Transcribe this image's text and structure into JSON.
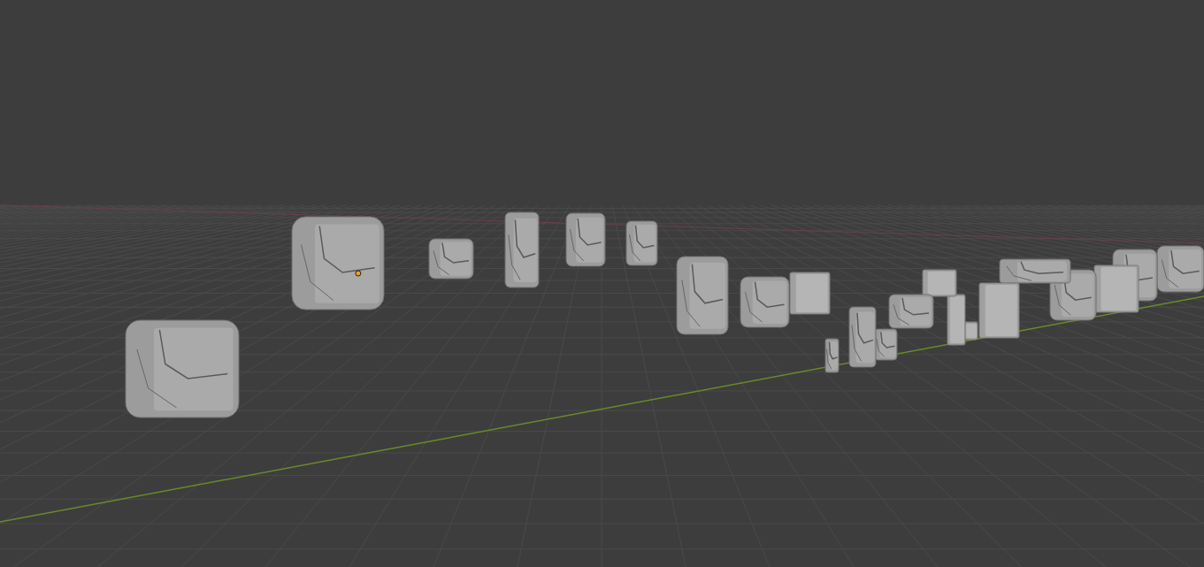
{
  "viewport": {
    "objects": [
      {
        "kind": "rough",
        "selected": false
      },
      {
        "kind": "rough",
        "selected": true
      },
      {
        "kind": "rough",
        "selected": false
      },
      {
        "kind": "rough",
        "selected": false
      },
      {
        "kind": "rough",
        "selected": false
      },
      {
        "kind": "rough",
        "selected": false
      },
      {
        "kind": "rough",
        "selected": false
      },
      {
        "kind": "rough",
        "selected": false
      },
      {
        "kind": "smooth",
        "selected": false
      },
      {
        "kind": "rough",
        "selected": false
      },
      {
        "kind": "rough",
        "selected": false
      },
      {
        "kind": "rough",
        "selected": false
      },
      {
        "kind": "rough",
        "selected": false
      },
      {
        "kind": "smooth",
        "selected": false
      },
      {
        "kind": "smooth",
        "selected": false
      },
      {
        "kind": "smooth",
        "selected": false
      },
      {
        "kind": "smooth",
        "selected": false
      },
      {
        "kind": "rough",
        "selected": false
      },
      {
        "kind": "rough",
        "selected": false
      },
      {
        "kind": "smooth",
        "selected": false
      },
      {
        "kind": "rough",
        "selected": false
      },
      {
        "kind": "rough",
        "selected": false
      }
    ]
  }
}
